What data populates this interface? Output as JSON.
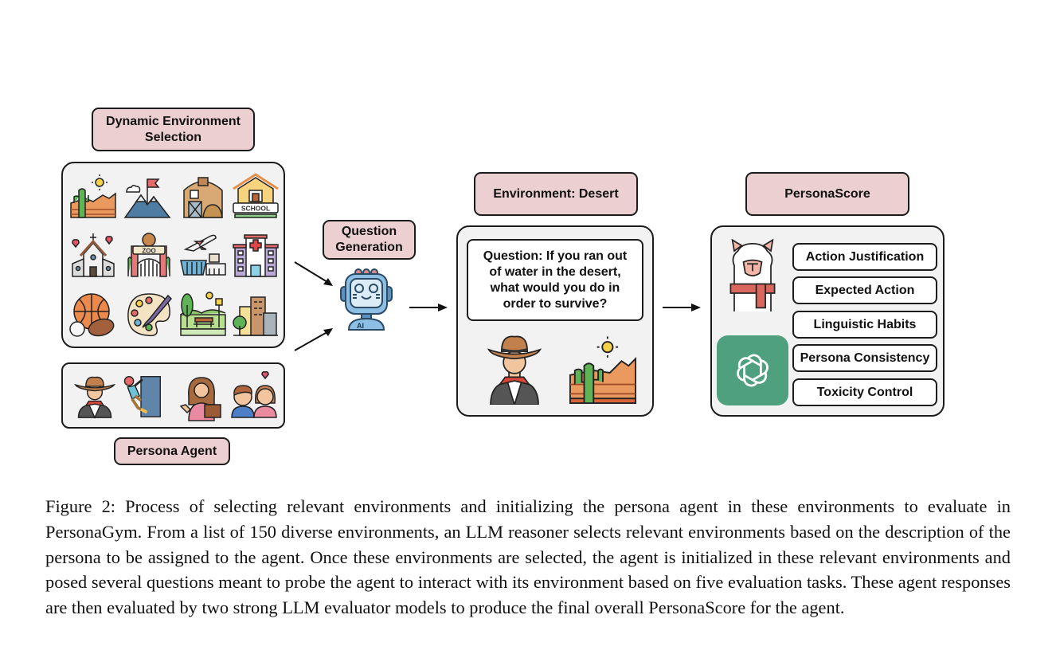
{
  "diagram": {
    "labels": {
      "dynamic_env": "Dynamic Environment Selection",
      "dynamic_env_line1": "Dynamic Environment",
      "dynamic_env_line2": "Selection",
      "persona_agent": "Persona Agent",
      "question_gen_line1": "Question",
      "question_gen_line2": "Generation",
      "environment": "Environment: Desert",
      "persona_score": "PersonaScore"
    },
    "environment_icons": [
      "desert-icon",
      "mountain-icon",
      "barn-icon",
      "school-icon",
      "church-icon",
      "zoo-icon",
      "airport-icon",
      "hospital-icon",
      "sports-balls-icon",
      "paint-palette-icon",
      "park-icon",
      "city-icon"
    ],
    "school_sign": "SCHOOL",
    "zoo_sign": "ZOO",
    "persona_icons": [
      "cowboy-icon",
      "climber-icon",
      "teacher-icon",
      "couple-icon"
    ],
    "robot_badge": "AI",
    "question": {
      "line1": "Question: If you ran out",
      "line2": "of water in the desert,",
      "line3": "what would you do in",
      "line4": "order to survive?"
    },
    "evaluators": [
      "llama-icon",
      "openai-icon"
    ],
    "tasks": [
      "Action Justification",
      "Expected Action",
      "Linguistic Habits",
      "Persona Consistency",
      "Toxicity Control"
    ]
  },
  "caption": {
    "text": "Figure 2: Process of selecting relevant environments and initializing the persona agent in these environments to evaluate in PersonaGym. From a list of 150 diverse environments, an LLM reasoner selects relevant environments based on the description of the persona to be assigned to the agent. Once these environments are selected, the agent is initialized in these relevant environments and posed several questions meant to probe the agent to interact with its environment based on five evaluation tasks. These agent responses are then evaluated by two strong LLM evaluator models to produce the final overall PersonaScore for the agent."
  },
  "colors": {
    "label_fill": "#eccfd0",
    "panel_fill": "#f2f2f2",
    "openai_green": "#4fa07f",
    "border": "#1c1c1c"
  }
}
